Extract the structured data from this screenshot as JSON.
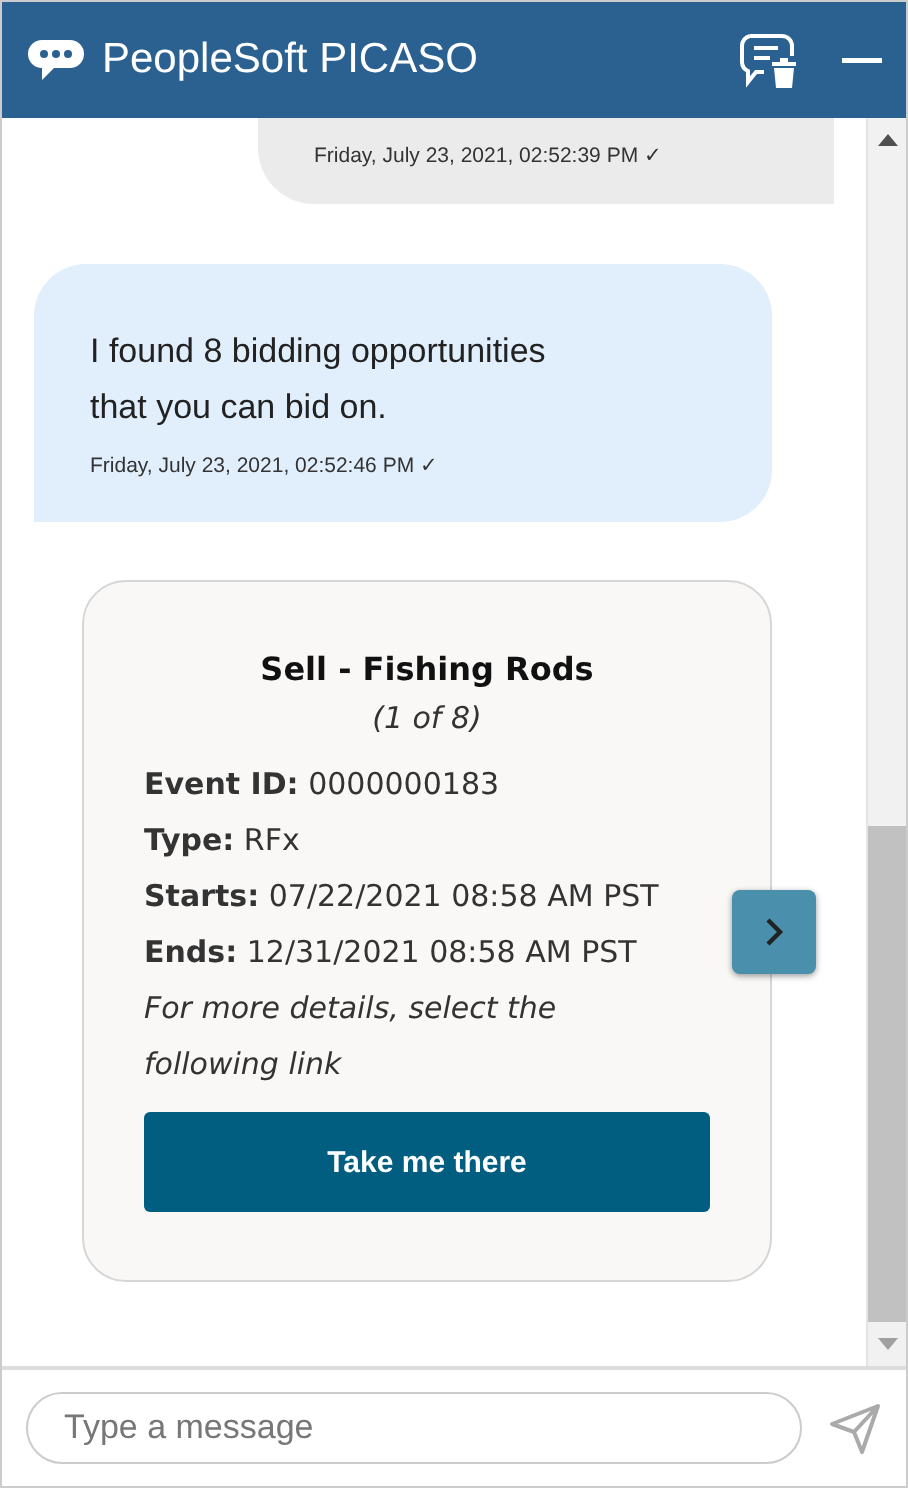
{
  "header": {
    "title": "PeopleSoft PICASO"
  },
  "messages": [
    {
      "kind": "user",
      "timestamp": "Friday, July 23, 2021, 02:52:39 PM ✓"
    },
    {
      "kind": "bot",
      "text": "I found 8 bidding opportunities that you can bid on.",
      "timestamp": "Friday, July 23, 2021, 02:52:46 PM ✓"
    }
  ],
  "card": {
    "title": "Sell - Fishing Rods",
    "subtitle": "(1 of 8)",
    "fields": [
      {
        "label": "Event ID:",
        "value": "0000000183"
      },
      {
        "label": "Type:",
        "value": "RFx"
      },
      {
        "label": "Starts:",
        "value": "07/22/2021 08:58 AM PST"
      },
      {
        "label": "Ends:",
        "value": "12/31/2021 08:58 AM PST"
      }
    ],
    "note": "For more details, select the following link",
    "button": "Take me there"
  },
  "composer": {
    "placeholder": "Type a message"
  }
}
